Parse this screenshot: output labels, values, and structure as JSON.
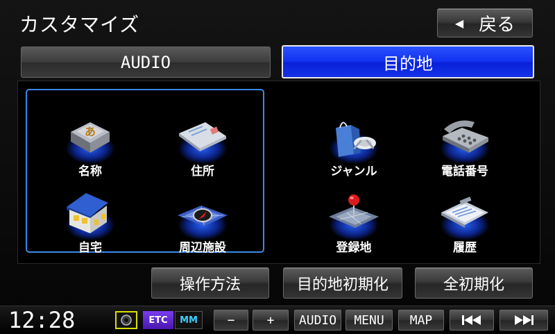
{
  "header": {
    "title": "カスタマイズ",
    "back_label": "戻る"
  },
  "tabs": [
    {
      "label": "AUDIO",
      "selected": false
    },
    {
      "label": "目的地",
      "selected": true
    }
  ],
  "items": [
    {
      "label": "名称",
      "icon": "kana-key-icon"
    },
    {
      "label": "住所",
      "icon": "envelope-icon"
    },
    {
      "label": "ジャンル",
      "icon": "shopping-bag-icon"
    },
    {
      "label": "電話番号",
      "icon": "telephone-icon"
    },
    {
      "label": "自宅",
      "icon": "house-icon"
    },
    {
      "label": "周辺施設",
      "icon": "compass-map-icon"
    },
    {
      "label": "登録地",
      "icon": "map-pin-icon"
    },
    {
      "label": "履歴",
      "icon": "clipboard-icon"
    }
  ],
  "bottom_buttons": {
    "howto": "操作方法",
    "dest_init": "目的地初期化",
    "all_init": "全初期化"
  },
  "statusbar": {
    "clock": "12:28",
    "etc": "ETC",
    "mm": "MM",
    "minus": "−",
    "plus": "+",
    "audio": "AUDIO",
    "menu": "MENU",
    "map": "MAP"
  },
  "colors": {
    "selected_tab": "#1030ee",
    "group_border": "#3a8ae8",
    "glow": "#2864ff",
    "etc": "#6a2ad0"
  }
}
